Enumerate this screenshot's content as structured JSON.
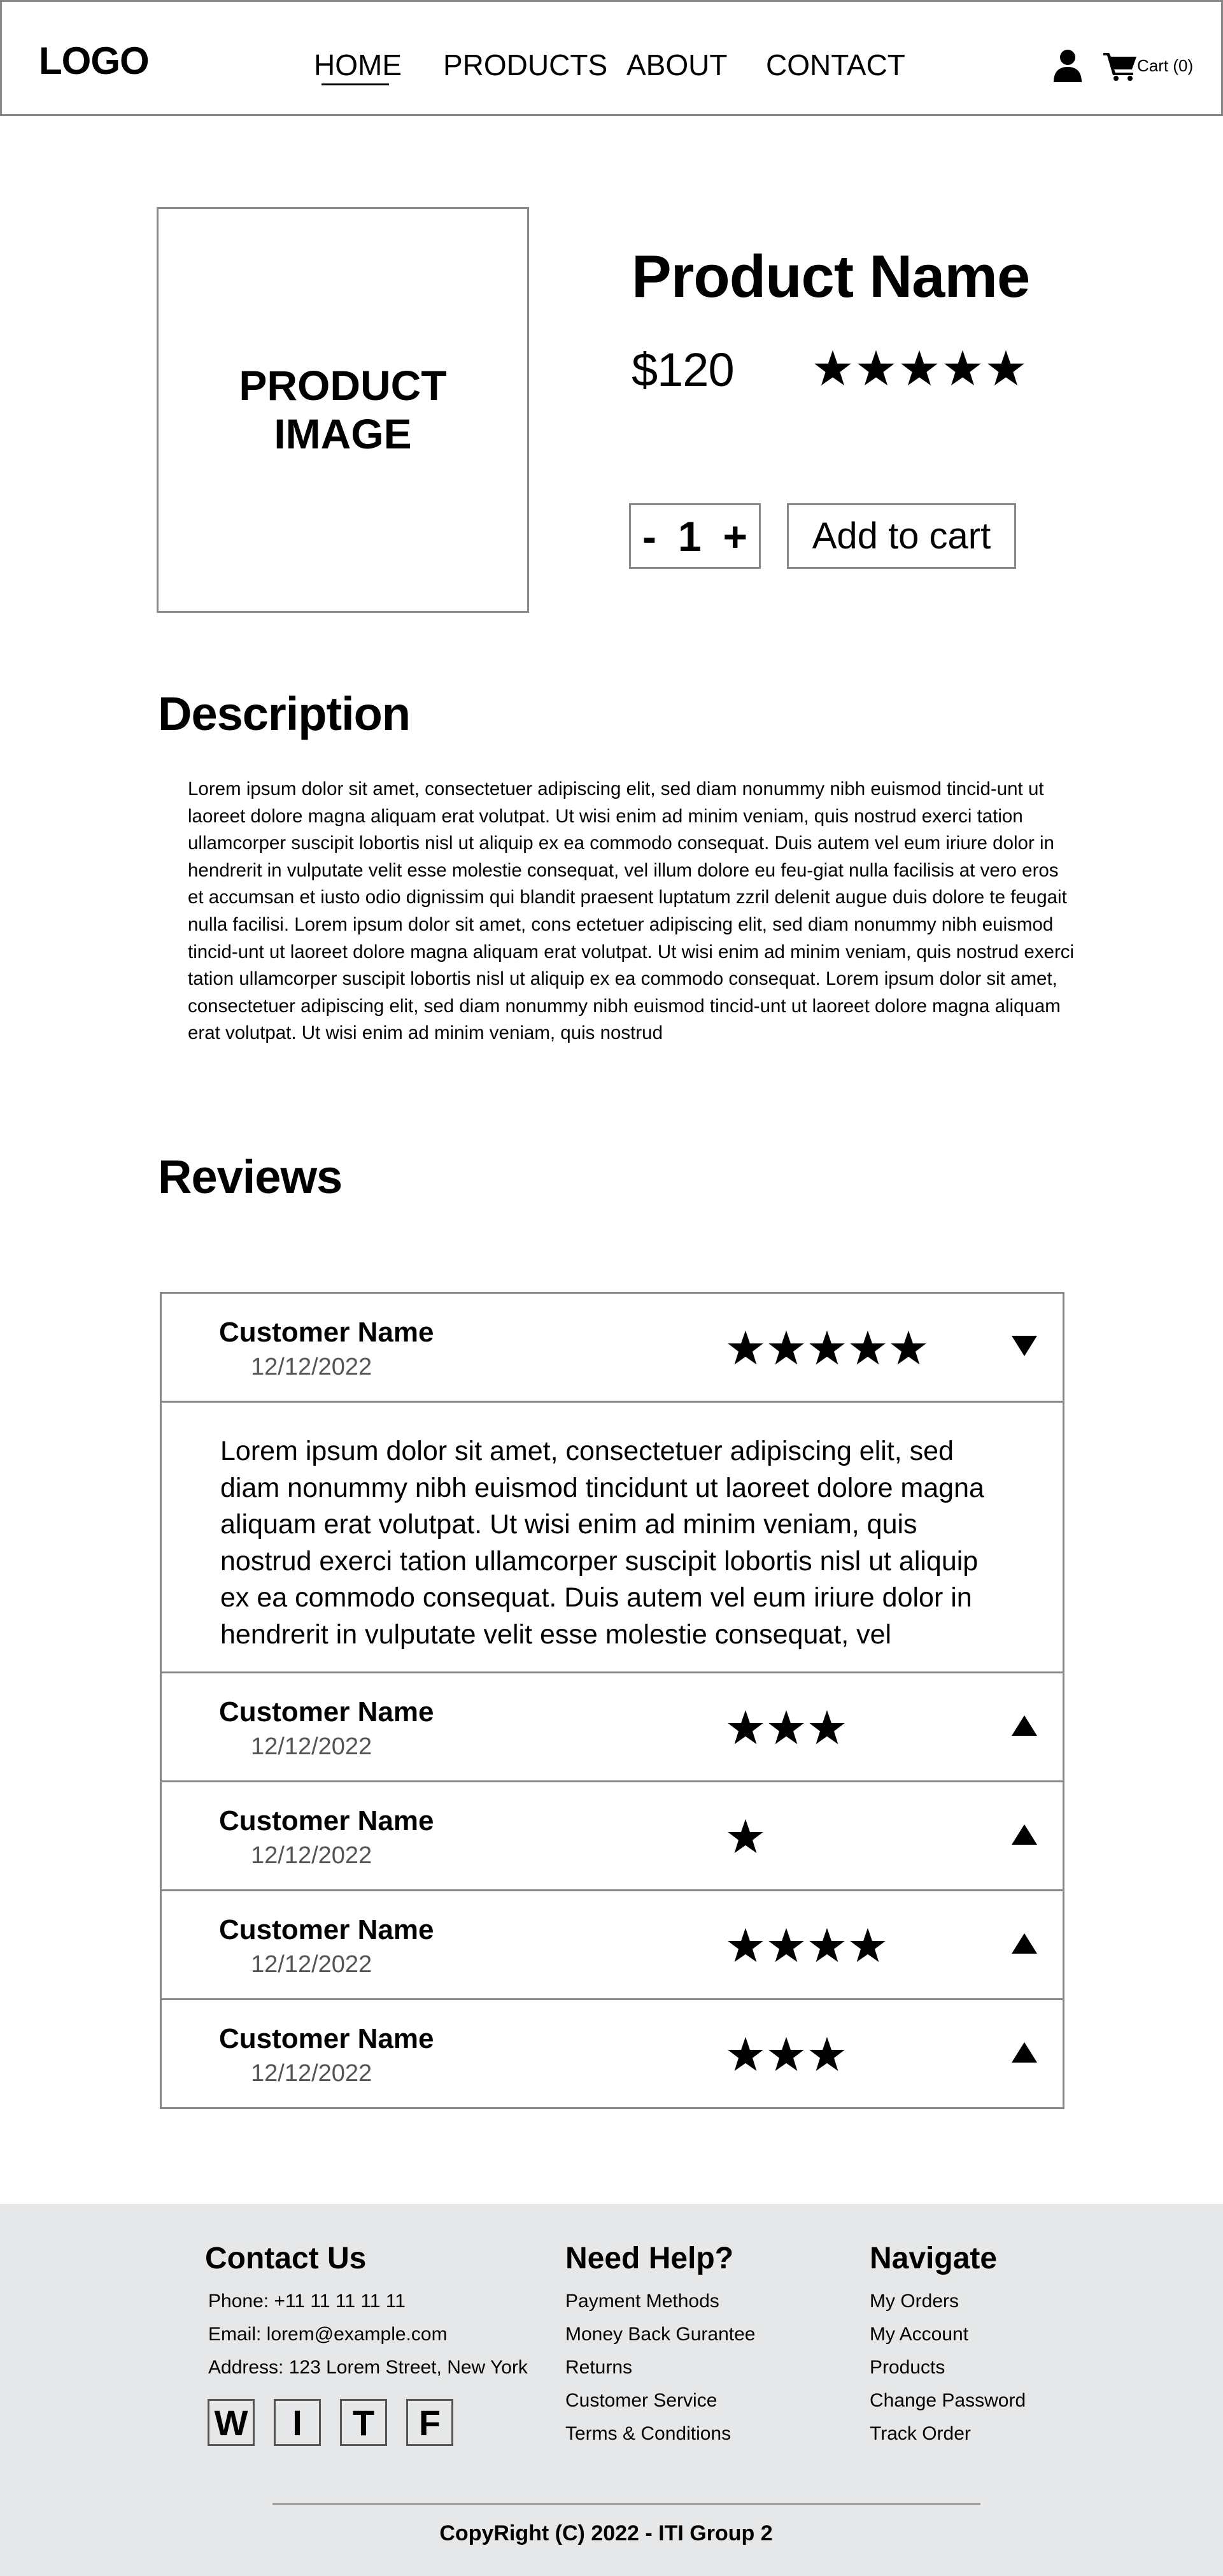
{
  "header": {
    "logo": "LOGO",
    "nav": [
      "HOME",
      "PRODUCTS",
      "ABOUT",
      "CONTACT"
    ],
    "cart_label": "Cart (0)"
  },
  "product": {
    "image_label": "PRODUCT IMAGE",
    "name": "Product Name",
    "price": "$120",
    "rating": 5,
    "quantity": "1",
    "minus": "-",
    "plus": "+",
    "add_to_cart": "Add to cart"
  },
  "description": {
    "title": "Description",
    "text": "Lorem ipsum dolor sit amet, consectetuer adipiscing elit, sed diam nonummy nibh euismod tincid-unt ut laoreet dolore magna aliquam erat volutpat. Ut wisi enim ad minim veniam, quis nostrud exerci tation ullamcorper suscipit lobortis nisl ut aliquip ex ea commodo consequat. Duis autem vel eum iriure dolor in hendrerit in vulputate velit esse molestie consequat, vel illum dolore eu feu-giat nulla facilisis at vero eros et accumsan et iusto odio dignissim qui blandit praesent luptatum zzril delenit augue duis dolore te feugait nulla facilisi. Lorem ipsum dolor sit amet, cons ectetuer adipiscing elit, sed diam nonummy nibh euismod tincid-unt ut laoreet dolore magna aliquam erat volutpat. Ut wisi enim ad minim veniam, quis nostrud exerci tation ullamcorper suscipit lobortis nisl ut aliquip ex ea commodo consequat. Lorem ipsum dolor sit amet, consectetuer adipiscing elit, sed diam nonummy nibh euismod tincid-unt ut laoreet dolore magna aliquam erat volutpat. Ut wisi enim ad minim veniam, quis nostrud"
  },
  "reviews": {
    "title": "Reviews",
    "items": [
      {
        "name": "Customer Name",
        "date": "12/12/2022",
        "rating": 5,
        "expanded": true,
        "text": "Lorem ipsum dolor sit amet, consectetuer adipiscing elit, sed diam nonummy nibh euismod tincidunt ut laoreet dolore magna aliquam erat volutpat. Ut wisi enim ad minim veniam, quis nostrud exerci tation ullamcorper suscipit lobortis nisl ut aliquip ex ea commodo consequat. Duis autem vel eum iriure dolor in hendrerit in vulputate velit esse molestie consequat, vel"
      },
      {
        "name": "Customer Name",
        "date": "12/12/2022",
        "rating": 3,
        "expanded": false
      },
      {
        "name": "Customer Name",
        "date": "12/12/2022",
        "rating": 1,
        "expanded": false
      },
      {
        "name": "Customer Name",
        "date": "12/12/2022",
        "rating": 4,
        "expanded": false
      },
      {
        "name": "Customer Name",
        "date": "12/12/2022",
        "rating": 3,
        "expanded": false
      }
    ]
  },
  "footer": {
    "contact": {
      "title": "Contact Us",
      "phone": "Phone: +11 11 11 11 11",
      "email": "Email: lorem@example.com",
      "address": "Address: 123 Lorem Street, New York"
    },
    "social": [
      "W",
      "I",
      "T",
      "F"
    ],
    "help": {
      "title": "Need Help?",
      "links": [
        "Payment Methods",
        "Money Back Gurantee",
        "Returns",
        "Customer Service",
        "Terms & Conditions"
      ]
    },
    "navigate": {
      "title": "Navigate",
      "links": [
        "My Orders",
        "My Account",
        "Products",
        "Change Password",
        "Track Order"
      ]
    },
    "copyright": "CopyRight (C) 2022 - ITI Group 2"
  }
}
